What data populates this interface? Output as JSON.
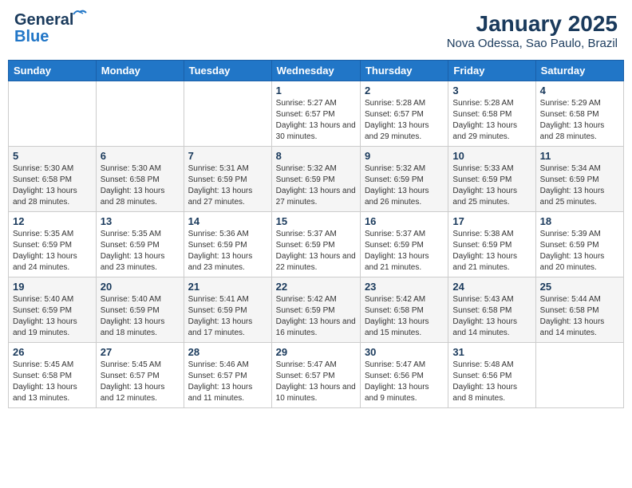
{
  "header": {
    "logo_line1": "General",
    "logo_line2": "Blue",
    "title": "January 2025",
    "subtitle": "Nova Odessa, Sao Paulo, Brazil"
  },
  "weekdays": [
    "Sunday",
    "Monday",
    "Tuesday",
    "Wednesday",
    "Thursday",
    "Friday",
    "Saturday"
  ],
  "weeks": [
    [
      {
        "day": "",
        "info": ""
      },
      {
        "day": "",
        "info": ""
      },
      {
        "day": "",
        "info": ""
      },
      {
        "day": "1",
        "info": "Sunrise: 5:27 AM\nSunset: 6:57 PM\nDaylight: 13 hours and 30 minutes."
      },
      {
        "day": "2",
        "info": "Sunrise: 5:28 AM\nSunset: 6:57 PM\nDaylight: 13 hours and 29 minutes."
      },
      {
        "day": "3",
        "info": "Sunrise: 5:28 AM\nSunset: 6:58 PM\nDaylight: 13 hours and 29 minutes."
      },
      {
        "day": "4",
        "info": "Sunrise: 5:29 AM\nSunset: 6:58 PM\nDaylight: 13 hours and 28 minutes."
      }
    ],
    [
      {
        "day": "5",
        "info": "Sunrise: 5:30 AM\nSunset: 6:58 PM\nDaylight: 13 hours and 28 minutes."
      },
      {
        "day": "6",
        "info": "Sunrise: 5:30 AM\nSunset: 6:58 PM\nDaylight: 13 hours and 28 minutes."
      },
      {
        "day": "7",
        "info": "Sunrise: 5:31 AM\nSunset: 6:59 PM\nDaylight: 13 hours and 27 minutes."
      },
      {
        "day": "8",
        "info": "Sunrise: 5:32 AM\nSunset: 6:59 PM\nDaylight: 13 hours and 27 minutes."
      },
      {
        "day": "9",
        "info": "Sunrise: 5:32 AM\nSunset: 6:59 PM\nDaylight: 13 hours and 26 minutes."
      },
      {
        "day": "10",
        "info": "Sunrise: 5:33 AM\nSunset: 6:59 PM\nDaylight: 13 hours and 25 minutes."
      },
      {
        "day": "11",
        "info": "Sunrise: 5:34 AM\nSunset: 6:59 PM\nDaylight: 13 hours and 25 minutes."
      }
    ],
    [
      {
        "day": "12",
        "info": "Sunrise: 5:35 AM\nSunset: 6:59 PM\nDaylight: 13 hours and 24 minutes."
      },
      {
        "day": "13",
        "info": "Sunrise: 5:35 AM\nSunset: 6:59 PM\nDaylight: 13 hours and 23 minutes."
      },
      {
        "day": "14",
        "info": "Sunrise: 5:36 AM\nSunset: 6:59 PM\nDaylight: 13 hours and 23 minutes."
      },
      {
        "day": "15",
        "info": "Sunrise: 5:37 AM\nSunset: 6:59 PM\nDaylight: 13 hours and 22 minutes."
      },
      {
        "day": "16",
        "info": "Sunrise: 5:37 AM\nSunset: 6:59 PM\nDaylight: 13 hours and 21 minutes."
      },
      {
        "day": "17",
        "info": "Sunrise: 5:38 AM\nSunset: 6:59 PM\nDaylight: 13 hours and 21 minutes."
      },
      {
        "day": "18",
        "info": "Sunrise: 5:39 AM\nSunset: 6:59 PM\nDaylight: 13 hours and 20 minutes."
      }
    ],
    [
      {
        "day": "19",
        "info": "Sunrise: 5:40 AM\nSunset: 6:59 PM\nDaylight: 13 hours and 19 minutes."
      },
      {
        "day": "20",
        "info": "Sunrise: 5:40 AM\nSunset: 6:59 PM\nDaylight: 13 hours and 18 minutes."
      },
      {
        "day": "21",
        "info": "Sunrise: 5:41 AM\nSunset: 6:59 PM\nDaylight: 13 hours and 17 minutes."
      },
      {
        "day": "22",
        "info": "Sunrise: 5:42 AM\nSunset: 6:59 PM\nDaylight: 13 hours and 16 minutes."
      },
      {
        "day": "23",
        "info": "Sunrise: 5:42 AM\nSunset: 6:58 PM\nDaylight: 13 hours and 15 minutes."
      },
      {
        "day": "24",
        "info": "Sunrise: 5:43 AM\nSunset: 6:58 PM\nDaylight: 13 hours and 14 minutes."
      },
      {
        "day": "25",
        "info": "Sunrise: 5:44 AM\nSunset: 6:58 PM\nDaylight: 13 hours and 14 minutes."
      }
    ],
    [
      {
        "day": "26",
        "info": "Sunrise: 5:45 AM\nSunset: 6:58 PM\nDaylight: 13 hours and 13 minutes."
      },
      {
        "day": "27",
        "info": "Sunrise: 5:45 AM\nSunset: 6:57 PM\nDaylight: 13 hours and 12 minutes."
      },
      {
        "day": "28",
        "info": "Sunrise: 5:46 AM\nSunset: 6:57 PM\nDaylight: 13 hours and 11 minutes."
      },
      {
        "day": "29",
        "info": "Sunrise: 5:47 AM\nSunset: 6:57 PM\nDaylight: 13 hours and 10 minutes."
      },
      {
        "day": "30",
        "info": "Sunrise: 5:47 AM\nSunset: 6:56 PM\nDaylight: 13 hours and 9 minutes."
      },
      {
        "day": "31",
        "info": "Sunrise: 5:48 AM\nSunset: 6:56 PM\nDaylight: 13 hours and 8 minutes."
      },
      {
        "day": "",
        "info": ""
      }
    ]
  ]
}
